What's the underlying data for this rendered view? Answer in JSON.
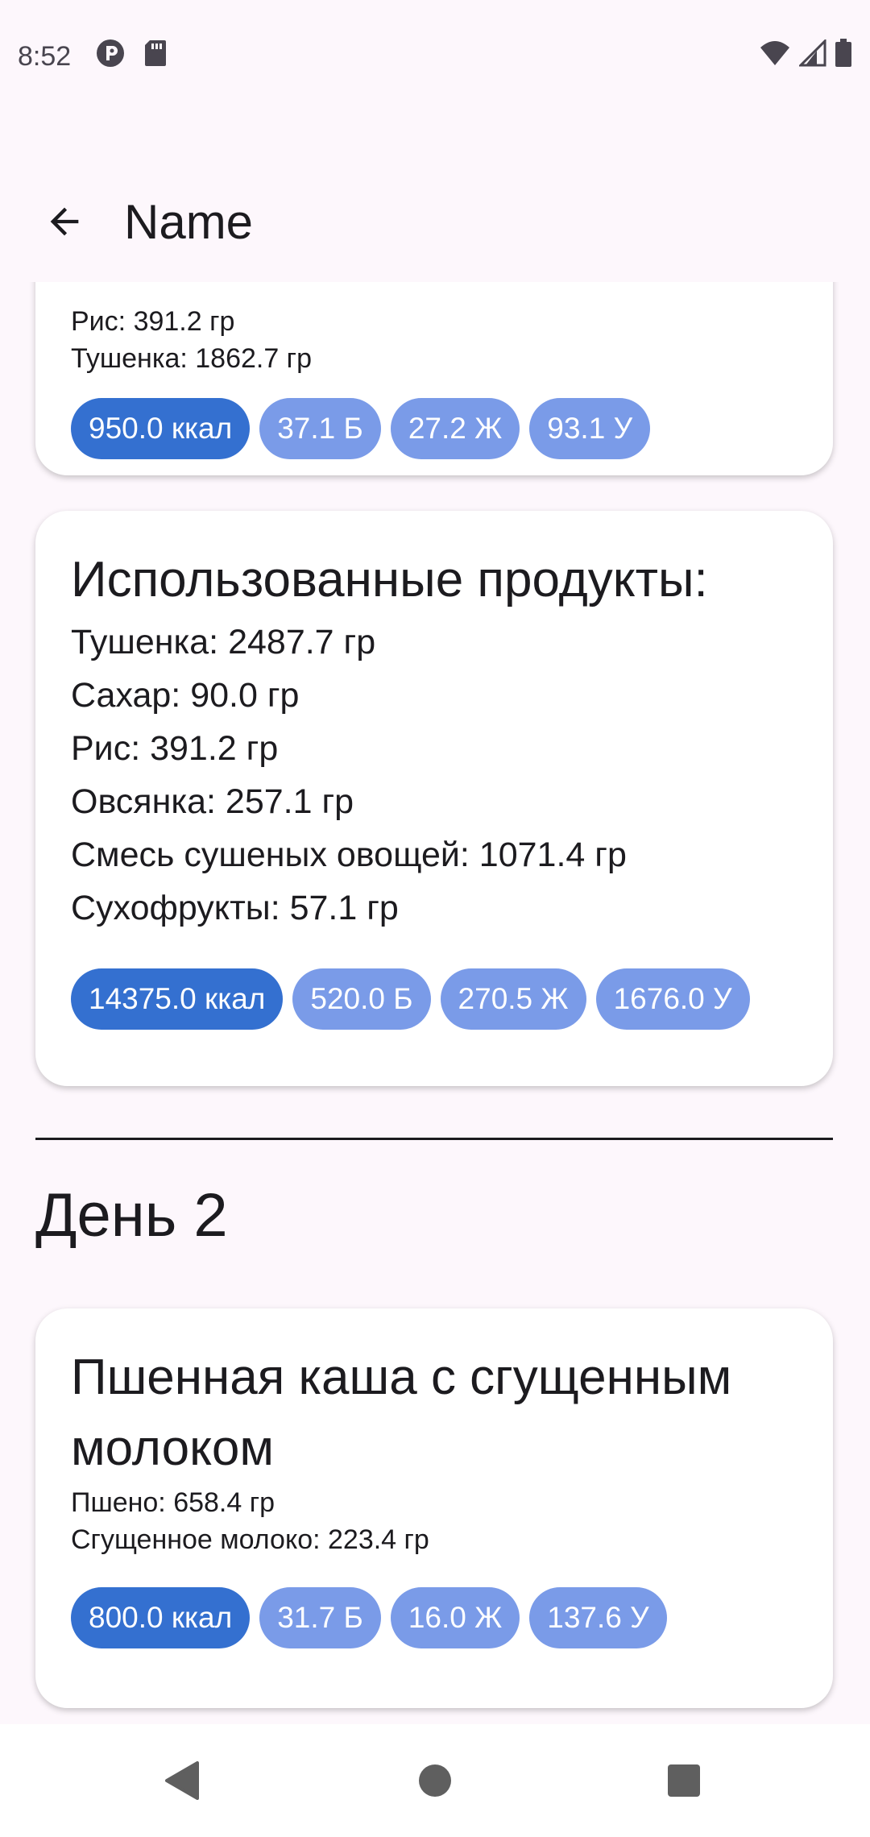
{
  "status_bar": {
    "time": "8:52",
    "left_icons": [
      "app-notification-icon",
      "sd-card-icon"
    ],
    "right_icons": [
      "wifi-icon",
      "signal-icon",
      "battery-icon"
    ]
  },
  "app_bar": {
    "back_icon": "arrow-back-icon",
    "title": "Name"
  },
  "cards": [
    {
      "lines": [
        "Рис: 391.2 гр",
        "Тушенка: 1862.7 гр"
      ],
      "chips": [
        "950.0 ккал",
        "37.1 Б",
        "27.2 Ж",
        "93.1 У"
      ]
    },
    {
      "title": "Использованные продукты:",
      "lines": [
        "Тушенка: 2487.7 гр",
        "Сахар: 90.0 гр",
        "Рис: 391.2 гр",
        "Овсянка: 257.1 гр",
        "Смесь сушеных овощей: 1071.4 гр",
        "Сухофрукты: 57.1 гр"
      ],
      "chips": [
        "14375.0 ккал",
        "520.0 Б",
        "270.5 Ж",
        "1676.0 У"
      ]
    },
    {
      "title_line1": "Пшенная каша с сгущенным",
      "title_line2": "молоком",
      "lines": [
        "Пшено: 658.4 гр",
        "Сгущенное молоко: 223.4 гр"
      ],
      "chips": [
        "800.0 ккал",
        "31.7 Б",
        "16.0 Ж",
        "137.6 У"
      ]
    }
  ],
  "day_title": "День 2",
  "colors": {
    "background": "#fdf7fc",
    "chip_kcal": "#3470d0",
    "chip_macro": "#7a9be8"
  },
  "nav_bar": {
    "icons": [
      "nav-back-icon",
      "nav-home-icon",
      "nav-recents-icon"
    ]
  }
}
